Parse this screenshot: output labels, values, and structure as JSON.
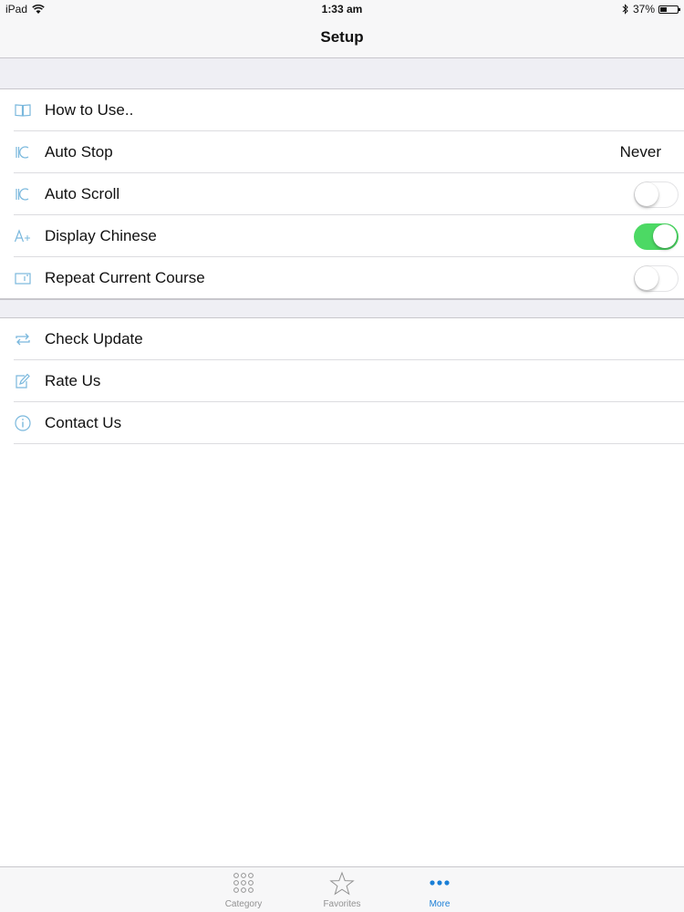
{
  "status_bar": {
    "device": "iPad",
    "time": "1:33 am",
    "battery": "37%",
    "battery_level": 0.37
  },
  "nav": {
    "title": "Setup"
  },
  "settings_group_1": [
    {
      "label": "How to Use..",
      "icon": "book-icon"
    },
    {
      "label": "Auto Stop",
      "icon": "auto-stop-icon",
      "value": "Never"
    },
    {
      "label": "Auto Scroll",
      "icon": "auto-scroll-icon",
      "toggle": false
    },
    {
      "label": "Display Chinese",
      "icon": "font-size-icon",
      "toggle": true
    },
    {
      "label": "Repeat Current Course",
      "icon": "repeat-course-icon",
      "toggle": false
    }
  ],
  "settings_group_2": [
    {
      "label": "Check Update",
      "icon": "refresh-icon"
    },
    {
      "label": "Rate Us",
      "icon": "edit-icon"
    },
    {
      "label": "Contact Us",
      "icon": "info-icon"
    }
  ],
  "tab_bar": {
    "tabs": [
      {
        "label": "Category",
        "icon": "grid-icon"
      },
      {
        "label": "Favorites",
        "icon": "star-icon"
      },
      {
        "label": "More",
        "icon": "more-icon",
        "active": true
      }
    ]
  },
  "colors": {
    "accent": "#1a7fd6",
    "icon_tint": "#7ab8dd",
    "toggle_on": "#4cd964",
    "separator": "#c8c7cc",
    "group_background": "#efeff4"
  }
}
